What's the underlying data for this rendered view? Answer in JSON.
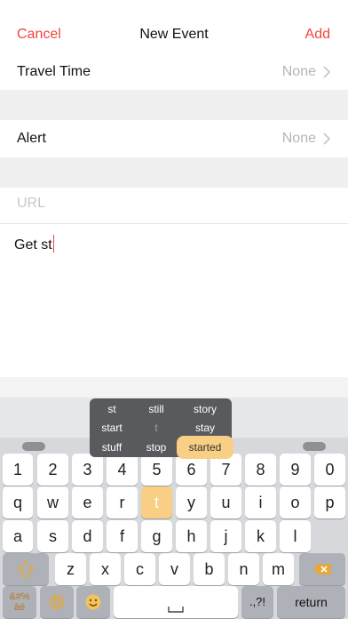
{
  "nav": {
    "cancel": "Cancel",
    "title": "New Event",
    "add": "Add"
  },
  "rows": {
    "travel_time": {
      "label": "Travel Time",
      "value": "None"
    },
    "alert": {
      "label": "Alert",
      "value": "None"
    }
  },
  "url": {
    "placeholder": "URL"
  },
  "notes": {
    "text": "Get st"
  },
  "suggestions": [
    "st",
    "still",
    "story",
    "start",
    "t",
    "stay",
    "stuff",
    "stop",
    "started"
  ],
  "keyboard": {
    "numbers": [
      "1",
      "2",
      "3",
      "4",
      "5",
      "6",
      "7",
      "8",
      "9",
      "0"
    ],
    "row_q": [
      "q",
      "w",
      "e",
      "r",
      "t",
      "y",
      "u",
      "i",
      "o",
      "p"
    ],
    "row_a": [
      "a",
      "s",
      "d",
      "f",
      "g",
      "h",
      "j",
      "k",
      "l"
    ],
    "row_z": [
      "z",
      "x",
      "c",
      "v",
      "b",
      "n",
      "m"
    ],
    "symbols_key": "&#%\nàé",
    "return_key": "return",
    "punct_key": ".,?!"
  },
  "colors": {
    "accent": "#f2453d",
    "highlight": "#f8cf84"
  }
}
